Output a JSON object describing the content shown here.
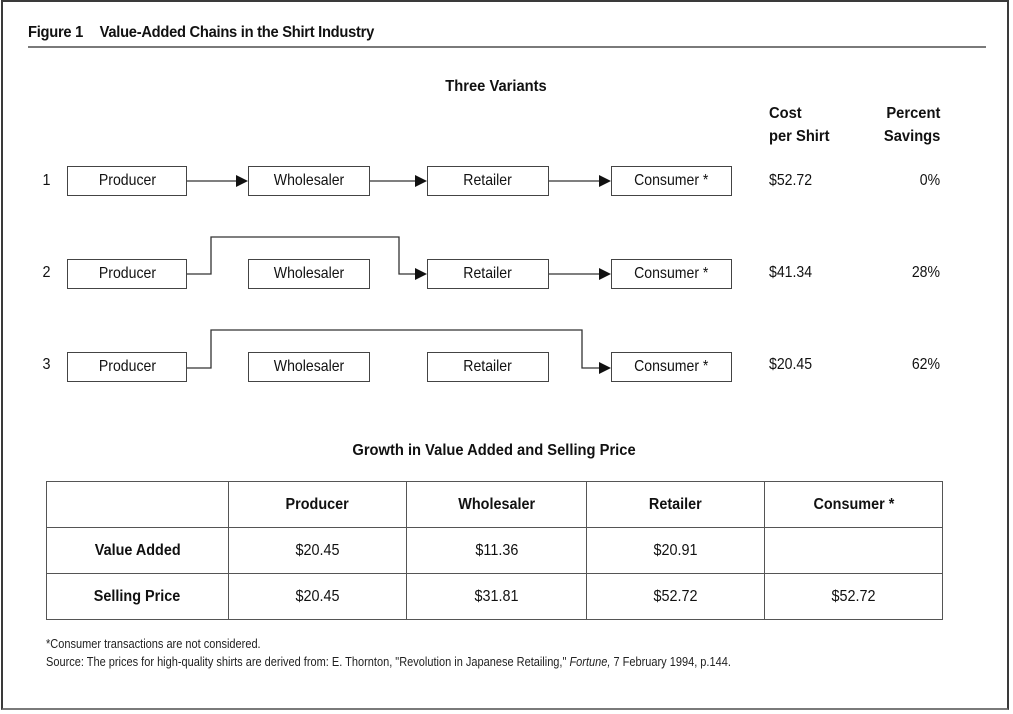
{
  "figure": {
    "number": "Figure 1",
    "title": "Value-Added Chains in the Shirt Industry"
  },
  "variants": {
    "title": "Three Variants",
    "cost_header_line1": "Cost",
    "cost_header_line2": "per Shirt",
    "savings_header_line1": "Percent",
    "savings_header_line2": "Savings",
    "stages": [
      "Producer",
      "Wholesaler",
      "Retailer",
      "Consumer *"
    ],
    "rows": [
      {
        "number": "1",
        "path": [
          "Producer",
          "Wholesaler",
          "Retailer",
          "Consumer *"
        ],
        "cost": "$52.72",
        "savings": "0%"
      },
      {
        "number": "2",
        "path": [
          "Producer",
          "Retailer",
          "Consumer *"
        ],
        "cost": "$41.34",
        "savings": "28%"
      },
      {
        "number": "3",
        "path": [
          "Producer",
          "Consumer *"
        ],
        "cost": "$20.45",
        "savings": "62%"
      }
    ]
  },
  "growth_table": {
    "title": "Growth in Value Added and Selling Price",
    "columns": [
      "",
      "Producer",
      "Wholesaler",
      "Retailer",
      "Consumer *"
    ],
    "rows": [
      {
        "label": "Value Added",
        "values": [
          "$20.45",
          "$11.36",
          "$20.91",
          ""
        ]
      },
      {
        "label": "Selling Price",
        "values": [
          "$20.45",
          "$31.81",
          "$52.72",
          "$52.72"
        ]
      }
    ]
  },
  "footnotes": {
    "note": "*Consumer transactions are not considered.",
    "source_prefix": "Source: The prices for high-quality shirts are derived from: E. Thornton, \"Revolution in Japanese Retailing,\" ",
    "source_publication": "Fortune,",
    "source_suffix": " 7 February 1994, p.144."
  }
}
